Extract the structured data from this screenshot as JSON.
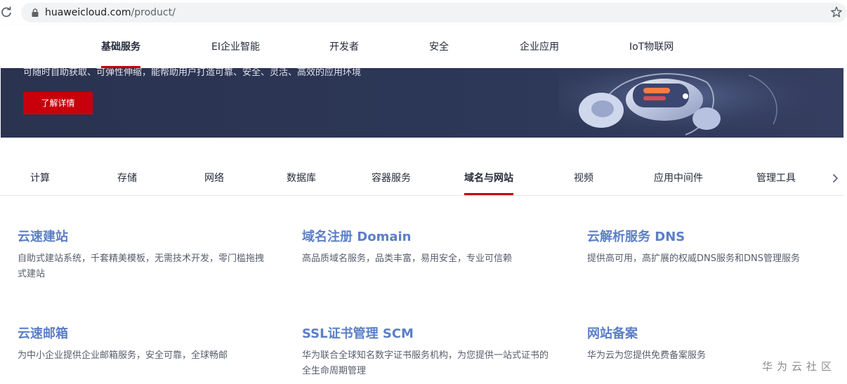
{
  "browser": {
    "url_domain": "huaweicloud.com",
    "url_path": "/product/"
  },
  "top_nav": {
    "items": [
      {
        "label": "基础服务",
        "active": true
      },
      {
        "label": "EI企业智能",
        "active": false
      },
      {
        "label": "开发者",
        "active": false
      },
      {
        "label": "安全",
        "active": false
      },
      {
        "label": "企业应用",
        "active": false
      },
      {
        "label": "IoT物联网",
        "active": false
      }
    ]
  },
  "banner": {
    "description": "可随时自助获取、可弹性伸缩，能帮助用户打造可靠、安全、灵活、高效的应用环境",
    "button_label": "了解详情"
  },
  "category_tabs": {
    "items": [
      {
        "label": "计算",
        "active": false
      },
      {
        "label": "存储",
        "active": false
      },
      {
        "label": "网络",
        "active": false
      },
      {
        "label": "数据库",
        "active": false
      },
      {
        "label": "容器服务",
        "active": false
      },
      {
        "label": "域名与网站",
        "active": true
      },
      {
        "label": "视频",
        "active": false
      },
      {
        "label": "应用中间件",
        "active": false
      },
      {
        "label": "管理工具",
        "active": false
      }
    ]
  },
  "products": [
    {
      "title": "云速建站",
      "desc": "自助式建站系统，千套精美模板，无需技术开发，零门槛拖拽式建站"
    },
    {
      "title": "域名注册 Domain",
      "desc": "高品质域名服务，品类丰富，易用安全，专业可信赖"
    },
    {
      "title": "云解析服务 DNS",
      "desc": "提供高可用，高扩展的权威DNS服务和DNS管理服务"
    },
    {
      "title": "云速邮箱",
      "desc": "为中小企业提供企业邮箱服务，安全可靠，全球畅邮"
    },
    {
      "title": "SSL证书管理 SCM",
      "desc": "华为联合全球知名数字证书服务机构，为您提供一站式证书的全生命周期管理"
    },
    {
      "title": "网站备案",
      "desc": "华为云为您提供免费备案服务"
    }
  ],
  "watermark": "华为云社区",
  "colors": {
    "brand_red": "#c7000b",
    "product_title_blue": "#5b7fc7",
    "banner_bg": "#2d3757"
  }
}
